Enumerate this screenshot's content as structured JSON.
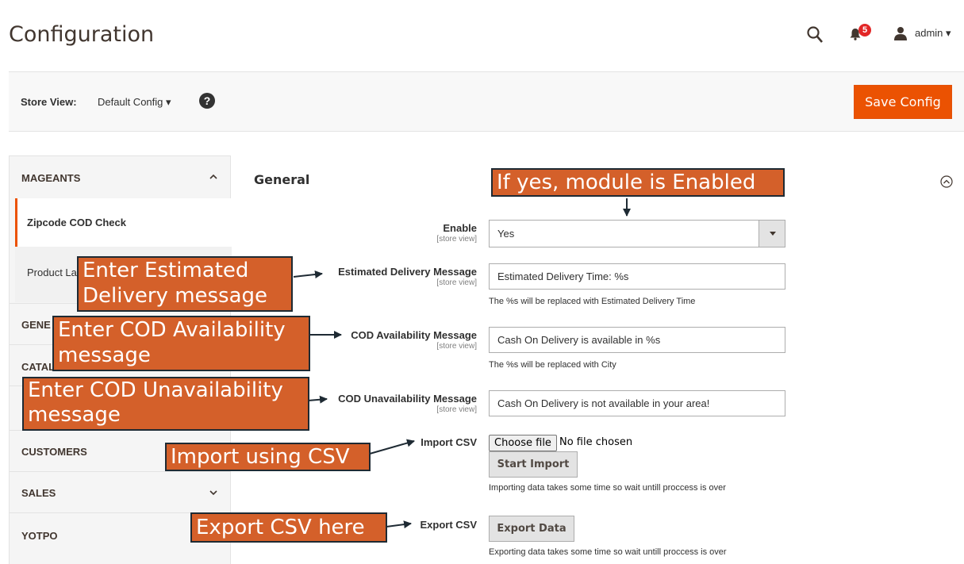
{
  "header": {
    "title": "Configuration",
    "notification_count": "5",
    "user_label": "admin ▾"
  },
  "store_bar": {
    "label": "Store View:",
    "switcher": "Default Config ▾",
    "help": "?",
    "save_label": "Save Config"
  },
  "sidebar": {
    "sections": [
      {
        "title": "MAGEANTS",
        "expanded": true
      },
      {
        "title": "GENE",
        "expanded": false
      },
      {
        "title": "CATAL",
        "expanded": false
      },
      {
        "title": "CUSTOMERS",
        "expanded": false
      },
      {
        "title": "SALES",
        "expanded": false
      },
      {
        "title": "YOTPO",
        "expanded": false
      }
    ],
    "items": [
      {
        "label": "Zipcode COD Check",
        "active": true
      },
      {
        "label": "Product La",
        "active": false
      }
    ]
  },
  "main": {
    "section_title": "General",
    "fields": {
      "enable": {
        "label": "Enable",
        "scope": "[store view]",
        "value": "Yes"
      },
      "estimated": {
        "label": "Estimated Delivery Message",
        "scope": "[store view]",
        "value": "Estimated Delivery Time: %s",
        "note": "The %s will be replaced with Estimated Delivery Time"
      },
      "cod_available": {
        "label": "COD Availability Message",
        "scope": "[store view]",
        "value": "Cash On Delivery is available in %s",
        "note": "The %s will be replaced with City"
      },
      "cod_unavailable": {
        "label": "COD Unavailability Message",
        "scope": "[store view]",
        "value": "Cash On Delivery is not available in your area!"
      },
      "import_csv": {
        "label": "Import CSV",
        "file_button": "Choose file",
        "file_status": "No file chosen",
        "button": "Start Import",
        "note": "Importing data takes some time so wait untill proccess is over"
      },
      "export_csv": {
        "label": "Export CSV",
        "button": "Export Data",
        "note": "Exporting data takes some time so wait untill proccess is over"
      }
    }
  },
  "annotations": {
    "enable": "If yes, module is Enabled",
    "estimated_line1": "Enter Estimated",
    "estimated_line2": "Delivery message",
    "cod_avail_line1": "Enter COD Availability",
    "cod_avail_line2": "message",
    "cod_unavail_line1": "Enter COD Unavailability",
    "cod_unavail_line2": "message",
    "import": "Import using CSV",
    "export": "Export CSV here"
  },
  "colors": {
    "accent": "#eb5202",
    "callout_bg": "#d4602a",
    "callout_border": "#1e2a33",
    "badge": "#e22626"
  }
}
